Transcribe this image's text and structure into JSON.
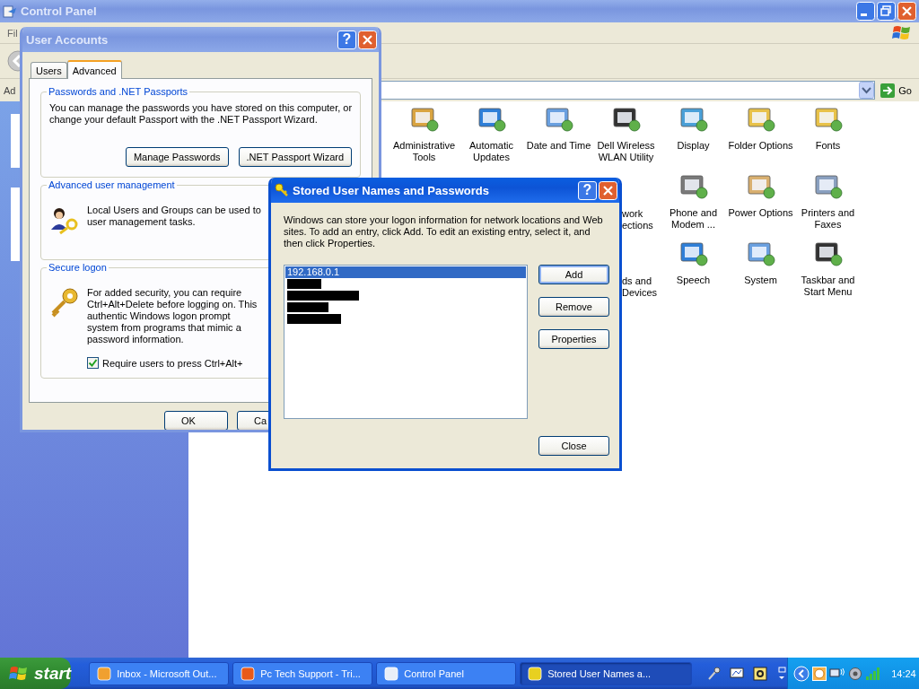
{
  "control_panel": {
    "title": "Control Panel",
    "active": false,
    "menu": [
      "Fil"
    ],
    "address_label": "Ad",
    "go_button": "Go",
    "applet_rows": [
      [
        {
          "label": [
            "Administrative",
            "Tools"
          ],
          "clipped": false
        },
        {
          "label": [
            "Automatic",
            "Updates"
          ],
          "clipped": false
        },
        {
          "label": [
            "Date and Time"
          ],
          "clipped": false
        },
        {
          "label": [
            "Dell Wireless",
            "WLAN Utility"
          ],
          "clipped": false
        },
        {
          "label": [
            "Display"
          ],
          "clipped": false
        },
        {
          "label": [
            "Folder Options"
          ],
          "clipped": false
        },
        {
          "label": [
            "Fonts"
          ],
          "clipped": false
        }
      ],
      [
        {
          "label": [
            "work",
            "ections"
          ],
          "clipped": true
        },
        {
          "label": [
            "Phone and",
            "Modem ..."
          ],
          "clipped": false
        },
        {
          "label": [
            "Power Options"
          ],
          "clipped": false
        },
        {
          "label": [
            "Printers and",
            "Faxes"
          ],
          "clipped": false
        }
      ],
      [
        {
          "label": [
            "ds and",
            "Devices"
          ],
          "clipped": true
        },
        {
          "label": [
            "Speech"
          ],
          "clipped": false
        },
        {
          "label": [
            "System"
          ],
          "clipped": false
        },
        {
          "label": [
            "Taskbar and",
            "Start Menu"
          ],
          "clipped": false
        }
      ]
    ]
  },
  "user_accounts": {
    "title": "User Accounts",
    "active": false,
    "help_button": "?",
    "tabs": [
      {
        "label": "Users",
        "selected": false
      },
      {
        "label": "Advanced",
        "selected": true
      }
    ],
    "passwords_group": {
      "title": "Passwords and .NET Passports",
      "text": [
        "You can manage the passwords you have stored on this computer, or",
        "change your default Passport with the .NET Passport Wizard."
      ],
      "buttons": [
        "Manage Passwords",
        ".NET Passport Wizard"
      ]
    },
    "management_group": {
      "title": "Advanced user management",
      "text": [
        "Local Users and Groups can be used to",
        "user management tasks."
      ]
    },
    "secure_logon_group": {
      "title": "Secure logon",
      "text": [
        "For added security, you can require",
        "Ctrl+Alt+Delete before logging on. This",
        "authentic Windows logon prompt",
        "system from programs that mimic a",
        "password information."
      ],
      "checkbox": {
        "label": "Require users to press Ctrl+Alt+",
        "checked": true
      }
    },
    "buttons": [
      "OK",
      "Ca"
    ]
  },
  "stored_dialog": {
    "title": "Stored User Names and Passwords",
    "active": true,
    "help_button": "?",
    "text": "Windows can store your logon information for network locations and Web sites. To add an entry, click Add. To edit an existing entry, select it, and then click Properties.",
    "entries": [
      {
        "kind": "text",
        "label": "192.168.0.1",
        "selected": true
      },
      {
        "kind": "redacted",
        "selected": false
      },
      {
        "kind": "redacted",
        "selected": false
      },
      {
        "kind": "redacted",
        "selected": false
      },
      {
        "kind": "redacted",
        "selected": false
      }
    ],
    "buttons": [
      "Add",
      "Remove",
      "Properties"
    ],
    "close_button": "Close"
  },
  "taskbar": {
    "start": "start",
    "tasks": [
      {
        "label": "Inbox - Microsoft Out...",
        "selected": false
      },
      {
        "label": "Pc Tech Support - Tri...",
        "selected": false
      },
      {
        "label": "Control Panel",
        "selected": false
      },
      {
        "label": "Stored User Names a...",
        "selected": true
      }
    ],
    "clock": "14:24"
  }
}
